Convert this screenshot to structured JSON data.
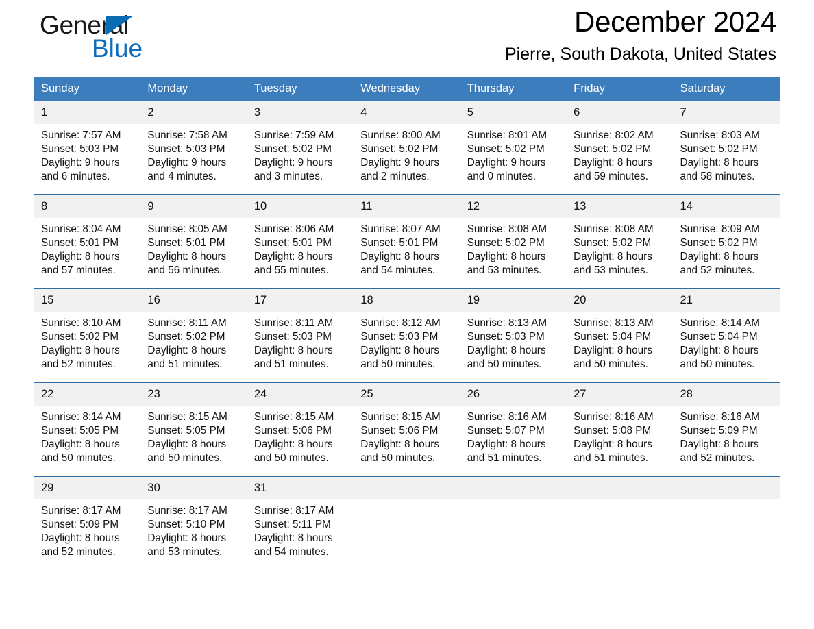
{
  "brand": {
    "name_part1": "General",
    "name_part2": "Blue",
    "accent_color": "#0d6ebd",
    "triangle_color": "#0a6cb4"
  },
  "header": {
    "title": "December 2024",
    "location": "Pierre, South Dakota, United States",
    "header_bg_color": "#3b7dbd",
    "row_divider_color": "#2e6da4",
    "daynum_bg_color": "#f1f1f1"
  },
  "weekday_headers": [
    "Sunday",
    "Monday",
    "Tuesday",
    "Wednesday",
    "Thursday",
    "Friday",
    "Saturday"
  ],
  "weeks": [
    [
      {
        "day": "1",
        "sunrise": "Sunrise: 7:57 AM",
        "sunset": "Sunset: 5:03 PM",
        "daylight_line1": "Daylight: 9 hours",
        "daylight_line2": "and 6 minutes."
      },
      {
        "day": "2",
        "sunrise": "Sunrise: 7:58 AM",
        "sunset": "Sunset: 5:03 PM",
        "daylight_line1": "Daylight: 9 hours",
        "daylight_line2": "and 4 minutes."
      },
      {
        "day": "3",
        "sunrise": "Sunrise: 7:59 AM",
        "sunset": "Sunset: 5:02 PM",
        "daylight_line1": "Daylight: 9 hours",
        "daylight_line2": "and 3 minutes."
      },
      {
        "day": "4",
        "sunrise": "Sunrise: 8:00 AM",
        "sunset": "Sunset: 5:02 PM",
        "daylight_line1": "Daylight: 9 hours",
        "daylight_line2": "and 2 minutes."
      },
      {
        "day": "5",
        "sunrise": "Sunrise: 8:01 AM",
        "sunset": "Sunset: 5:02 PM",
        "daylight_line1": "Daylight: 9 hours",
        "daylight_line2": "and 0 minutes."
      },
      {
        "day": "6",
        "sunrise": "Sunrise: 8:02 AM",
        "sunset": "Sunset: 5:02 PM",
        "daylight_line1": "Daylight: 8 hours",
        "daylight_line2": "and 59 minutes."
      },
      {
        "day": "7",
        "sunrise": "Sunrise: 8:03 AM",
        "sunset": "Sunset: 5:02 PM",
        "daylight_line1": "Daylight: 8 hours",
        "daylight_line2": "and 58 minutes."
      }
    ],
    [
      {
        "day": "8",
        "sunrise": "Sunrise: 8:04 AM",
        "sunset": "Sunset: 5:01 PM",
        "daylight_line1": "Daylight: 8 hours",
        "daylight_line2": "and 57 minutes."
      },
      {
        "day": "9",
        "sunrise": "Sunrise: 8:05 AM",
        "sunset": "Sunset: 5:01 PM",
        "daylight_line1": "Daylight: 8 hours",
        "daylight_line2": "and 56 minutes."
      },
      {
        "day": "10",
        "sunrise": "Sunrise: 8:06 AM",
        "sunset": "Sunset: 5:01 PM",
        "daylight_line1": "Daylight: 8 hours",
        "daylight_line2": "and 55 minutes."
      },
      {
        "day": "11",
        "sunrise": "Sunrise: 8:07 AM",
        "sunset": "Sunset: 5:01 PM",
        "daylight_line1": "Daylight: 8 hours",
        "daylight_line2": "and 54 minutes."
      },
      {
        "day": "12",
        "sunrise": "Sunrise: 8:08 AM",
        "sunset": "Sunset: 5:02 PM",
        "daylight_line1": "Daylight: 8 hours",
        "daylight_line2": "and 53 minutes."
      },
      {
        "day": "13",
        "sunrise": "Sunrise: 8:08 AM",
        "sunset": "Sunset: 5:02 PM",
        "daylight_line1": "Daylight: 8 hours",
        "daylight_line2": "and 53 minutes."
      },
      {
        "day": "14",
        "sunrise": "Sunrise: 8:09 AM",
        "sunset": "Sunset: 5:02 PM",
        "daylight_line1": "Daylight: 8 hours",
        "daylight_line2": "and 52 minutes."
      }
    ],
    [
      {
        "day": "15",
        "sunrise": "Sunrise: 8:10 AM",
        "sunset": "Sunset: 5:02 PM",
        "daylight_line1": "Daylight: 8 hours",
        "daylight_line2": "and 52 minutes."
      },
      {
        "day": "16",
        "sunrise": "Sunrise: 8:11 AM",
        "sunset": "Sunset: 5:02 PM",
        "daylight_line1": "Daylight: 8 hours",
        "daylight_line2": "and 51 minutes."
      },
      {
        "day": "17",
        "sunrise": "Sunrise: 8:11 AM",
        "sunset": "Sunset: 5:03 PM",
        "daylight_line1": "Daylight: 8 hours",
        "daylight_line2": "and 51 minutes."
      },
      {
        "day": "18",
        "sunrise": "Sunrise: 8:12 AM",
        "sunset": "Sunset: 5:03 PM",
        "daylight_line1": "Daylight: 8 hours",
        "daylight_line2": "and 50 minutes."
      },
      {
        "day": "19",
        "sunrise": "Sunrise: 8:13 AM",
        "sunset": "Sunset: 5:03 PM",
        "daylight_line1": "Daylight: 8 hours",
        "daylight_line2": "and 50 minutes."
      },
      {
        "day": "20",
        "sunrise": "Sunrise: 8:13 AM",
        "sunset": "Sunset: 5:04 PM",
        "daylight_line1": "Daylight: 8 hours",
        "daylight_line2": "and 50 minutes."
      },
      {
        "day": "21",
        "sunrise": "Sunrise: 8:14 AM",
        "sunset": "Sunset: 5:04 PM",
        "daylight_line1": "Daylight: 8 hours",
        "daylight_line2": "and 50 minutes."
      }
    ],
    [
      {
        "day": "22",
        "sunrise": "Sunrise: 8:14 AM",
        "sunset": "Sunset: 5:05 PM",
        "daylight_line1": "Daylight: 8 hours",
        "daylight_line2": "and 50 minutes."
      },
      {
        "day": "23",
        "sunrise": "Sunrise: 8:15 AM",
        "sunset": "Sunset: 5:05 PM",
        "daylight_line1": "Daylight: 8 hours",
        "daylight_line2": "and 50 minutes."
      },
      {
        "day": "24",
        "sunrise": "Sunrise: 8:15 AM",
        "sunset": "Sunset: 5:06 PM",
        "daylight_line1": "Daylight: 8 hours",
        "daylight_line2": "and 50 minutes."
      },
      {
        "day": "25",
        "sunrise": "Sunrise: 8:15 AM",
        "sunset": "Sunset: 5:06 PM",
        "daylight_line1": "Daylight: 8 hours",
        "daylight_line2": "and 50 minutes."
      },
      {
        "day": "26",
        "sunrise": "Sunrise: 8:16 AM",
        "sunset": "Sunset: 5:07 PM",
        "daylight_line1": "Daylight: 8 hours",
        "daylight_line2": "and 51 minutes."
      },
      {
        "day": "27",
        "sunrise": "Sunrise: 8:16 AM",
        "sunset": "Sunset: 5:08 PM",
        "daylight_line1": "Daylight: 8 hours",
        "daylight_line2": "and 51 minutes."
      },
      {
        "day": "28",
        "sunrise": "Sunrise: 8:16 AM",
        "sunset": "Sunset: 5:09 PM",
        "daylight_line1": "Daylight: 8 hours",
        "daylight_line2": "and 52 minutes."
      }
    ],
    [
      {
        "day": "29",
        "sunrise": "Sunrise: 8:17 AM",
        "sunset": "Sunset: 5:09 PM",
        "daylight_line1": "Daylight: 8 hours",
        "daylight_line2": "and 52 minutes."
      },
      {
        "day": "30",
        "sunrise": "Sunrise: 8:17 AM",
        "sunset": "Sunset: 5:10 PM",
        "daylight_line1": "Daylight: 8 hours",
        "daylight_line2": "and 53 minutes."
      },
      {
        "day": "31",
        "sunrise": "Sunrise: 8:17 AM",
        "sunset": "Sunset: 5:11 PM",
        "daylight_line1": "Daylight: 8 hours",
        "daylight_line2": "and 54 minutes."
      },
      {
        "day": "",
        "sunrise": "",
        "sunset": "",
        "daylight_line1": "",
        "daylight_line2": ""
      },
      {
        "day": "",
        "sunrise": "",
        "sunset": "",
        "daylight_line1": "",
        "daylight_line2": ""
      },
      {
        "day": "",
        "sunrise": "",
        "sunset": "",
        "daylight_line1": "",
        "daylight_line2": ""
      },
      {
        "day": "",
        "sunrise": "",
        "sunset": "",
        "daylight_line1": "",
        "daylight_line2": ""
      }
    ]
  ]
}
